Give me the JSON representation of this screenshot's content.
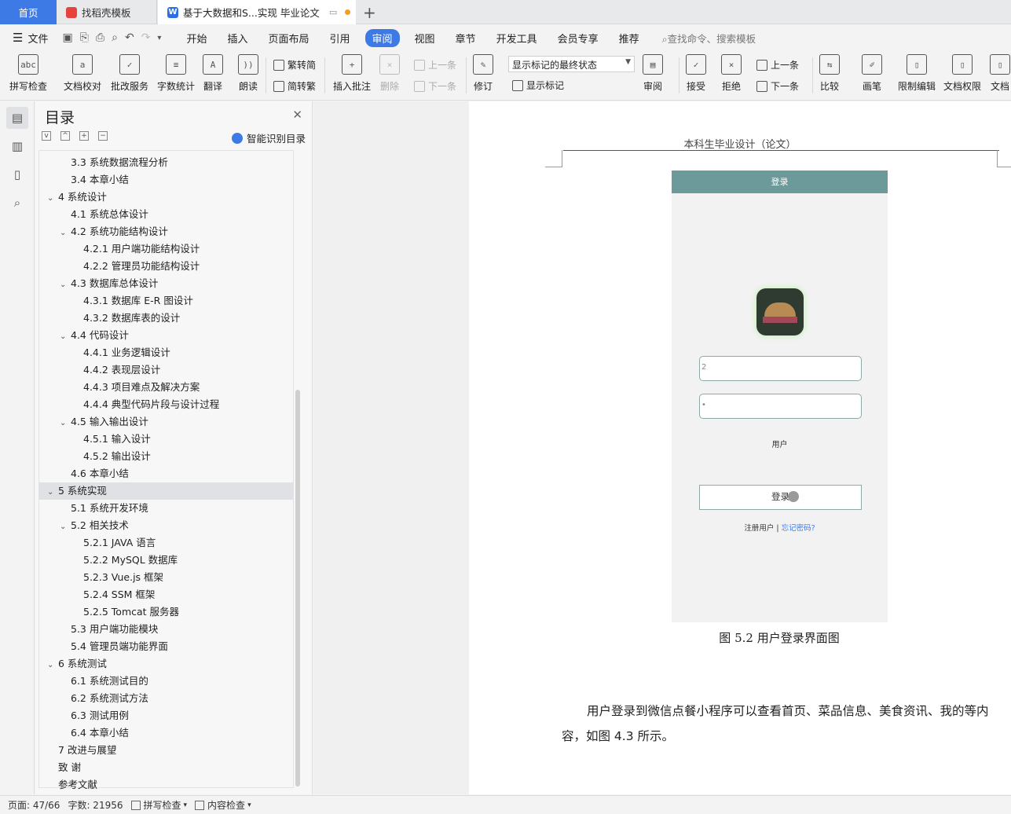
{
  "tabs": {
    "home": "首页",
    "template": "找稻壳模板",
    "document": "基于大数据和S...实现 毕业论文",
    "doc_logo": "W"
  },
  "menubar": {
    "file": "文件",
    "items": [
      "开始",
      "插入",
      "页面布局",
      "引用",
      "审阅",
      "视图",
      "章节",
      "开发工具",
      "会员专享",
      "推荐"
    ],
    "active": "审阅",
    "search_placeholder": "查找命令、搜索模板"
  },
  "ribbon": {
    "spell_check": "拼写检查",
    "spell_icon": "abc",
    "doc_proofread": "文档校对",
    "batch_service": "批改服务",
    "word_count": "字数统计",
    "translate": "翻译",
    "read_aloud": "朗读",
    "trad_simp": "繁转简",
    "simp_trad": "简转繁",
    "insert_comment": "插入批注",
    "delete": "删除",
    "prev1": "上一条",
    "next1": "下一条",
    "revise": "修订",
    "markup_state": "显示标记的最终状态",
    "show_markup": "显示标记",
    "review": "审阅",
    "accept": "接受",
    "reject": "拒绝",
    "prev2": "上一条",
    "next2": "下一条",
    "compare": "比较",
    "pen": "画笔",
    "restrict_edit": "限制编辑",
    "doc_permission": "文档权限",
    "doc_more": "文档"
  },
  "toc": {
    "title": "目录",
    "smart": "智能识别目录",
    "items": [
      {
        "level": 2,
        "label": "3.3 系统数据流程分析",
        "chev": ""
      },
      {
        "level": 2,
        "label": "3.4 本章小结",
        "chev": ""
      },
      {
        "level": 1,
        "label": "4  系统设计",
        "chev": "v"
      },
      {
        "level": 2,
        "label": "4.1 系统总体设计",
        "chev": ""
      },
      {
        "level": 2,
        "label": "4.2 系统功能结构设计",
        "chev": "v"
      },
      {
        "level": 3,
        "label": "4.2.1 用户端功能结构设计",
        "chev": ""
      },
      {
        "level": 3,
        "label": "4.2.2 管理员功能结构设计",
        "chev": ""
      },
      {
        "level": 2,
        "label": "4.3 数据库总体设计",
        "chev": "v"
      },
      {
        "level": 3,
        "label": "4.3.1  数据库 E-R 图设计",
        "chev": ""
      },
      {
        "level": 3,
        "label": "4.3.2  数据库表的设计",
        "chev": ""
      },
      {
        "level": 2,
        "label": "4.4 代码设计",
        "chev": "v"
      },
      {
        "level": 3,
        "label": "4.4.1 业务逻辑设计",
        "chev": ""
      },
      {
        "level": 3,
        "label": "4.4.2 表现层设计",
        "chev": ""
      },
      {
        "level": 3,
        "label": "4.4.3 项目难点及解决方案",
        "chev": ""
      },
      {
        "level": 3,
        "label": "4.4.4 典型代码片段与设计过程",
        "chev": ""
      },
      {
        "level": 2,
        "label": "4.5 输入输出设计",
        "chev": "v"
      },
      {
        "level": 3,
        "label": "4.5.1 输入设计",
        "chev": ""
      },
      {
        "level": 3,
        "label": "4.5.2 输出设计",
        "chev": ""
      },
      {
        "level": 2,
        "label": "4.6 本章小结",
        "chev": ""
      },
      {
        "level": 1,
        "label": "5  系统实现",
        "chev": "v",
        "selected": true
      },
      {
        "level": 2,
        "label": "5.1 系统开发环境",
        "chev": ""
      },
      {
        "level": 2,
        "label": "5.2 相关技术",
        "chev": "v"
      },
      {
        "level": 3,
        "label": "5.2.1 JAVA 语言",
        "chev": ""
      },
      {
        "level": 3,
        "label": "5.2.2 MySQL 数据库",
        "chev": ""
      },
      {
        "level": 3,
        "label": "5.2.3 Vue.js 框架",
        "chev": ""
      },
      {
        "level": 3,
        "label": "5.2.4 SSM 框架",
        "chev": ""
      },
      {
        "level": 3,
        "label": "5.2.5 Tomcat 服务器",
        "chev": ""
      },
      {
        "level": 2,
        "label": "5.3 用户端功能模块",
        "chev": ""
      },
      {
        "level": 2,
        "label": "5.4 管理员端功能界面",
        "chev": ""
      },
      {
        "level": 1,
        "label": "6 系统测试",
        "chev": "v"
      },
      {
        "level": 2,
        "label": "6.1 系统测试目的",
        "chev": ""
      },
      {
        "level": 2,
        "label": "6.2 系统测试方法",
        "chev": ""
      },
      {
        "level": 2,
        "label": "6.3 测试用例",
        "chev": ""
      },
      {
        "level": 2,
        "label": "6.4 本章小结",
        "chev": ""
      },
      {
        "level": 1,
        "label": "7 改进与展望",
        "chev": ""
      },
      {
        "level": 1,
        "label": "致   谢",
        "chev": ""
      },
      {
        "level": 1,
        "label": "参考文献",
        "chev": ""
      }
    ]
  },
  "document": {
    "header": "本科生毕业设计（论文）",
    "phone": {
      "title": "登录",
      "username_value": "2",
      "password_value": "•",
      "user_type": "用户",
      "login_button": "登录",
      "register": "注册用户",
      "separator": "|",
      "forgot": "忘记密码?"
    },
    "caption": "图 5.2 用户登录界面图",
    "body_line1": "用户登录到微信点餐小程序可以查看首页、菜品信息、美食资讯、我的等内",
    "body_line2": "容，如图 4.3 所示。"
  },
  "status": {
    "page": "页面: 47/66",
    "words": "字数: 21956",
    "spell": "拼写检查",
    "content": "内容检查"
  },
  "colors": {
    "accent": "#3d7ae6",
    "phone_header": "#6c9a9b"
  }
}
